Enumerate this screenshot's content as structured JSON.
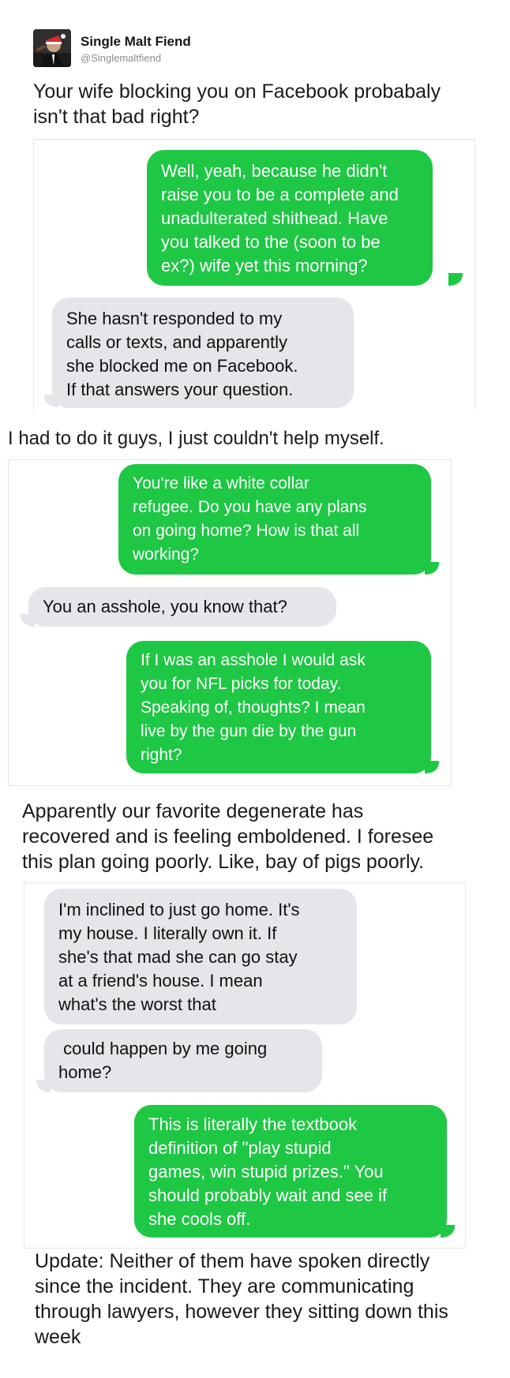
{
  "tweet": {
    "display_name": "Single Malt Fiend",
    "handle": "@Singlemaltfiend",
    "text": "Your wife blocking you on Facebook probabaly\nisn't that bad right?"
  },
  "thread1": [
    {
      "from": "sent",
      "text": "Well, yeah, because he didn't\nraise you to be a complete and\nunadulterated shithead. Have\nyou talked to the (soon to be\nex?) wife yet this morning?"
    },
    {
      "from": "recv",
      "text": "She hasn't responded to my\ncalls or texts, and apparently\nshe blocked me on Facebook.\nIf that answers your question."
    }
  ],
  "caption2": "I had to do it guys, I just couldn't help myself.",
  "thread2": [
    {
      "from": "sent",
      "text": "You're like a white collar\nrefugee. Do you have any plans\non going home? How is that all\nworking?"
    },
    {
      "from": "recv",
      "text": "You an asshole, you know that?"
    },
    {
      "from": "sent",
      "text": "If I was an asshole I would ask\nyou for NFL picks for today.\nSpeaking of, thoughts? I mean\nlive by the gun die by the gun\nright?"
    }
  ],
  "caption3": "Apparently our favorite degenerate has\nrecovered and is feeling emboldened. I foresee\nthis plan going poorly. Like, bay of pigs poorly.",
  "thread3": [
    {
      "from": "recv",
      "text": "I'm inclined to just go home. It's\nmy house. I literally own it. If\nshe's that mad she can go stay\nat a friend's house. I mean\nwhat's the worst that"
    },
    {
      "from": "recv",
      "text": " could happen by me going\nhome?"
    },
    {
      "from": "sent",
      "text": "This is literally the textbook\ndefinition of \"play stupid\ngames, win stupid prizes.\" You\nshould probably wait and see if\nshe cools off."
    }
  ],
  "caption4": "Update: Neither of them have spoken directly\nsince the incident. They are communicating\nthrough lawyers, however they sitting down this\nweek",
  "colors": {
    "sent_bubble": "#1ec744",
    "recv_bubble": "#e5e5ea",
    "handle": "#8a8f94"
  },
  "icons": {
    "avatar": "man-with-santa-hat-drinking-avatar"
  }
}
